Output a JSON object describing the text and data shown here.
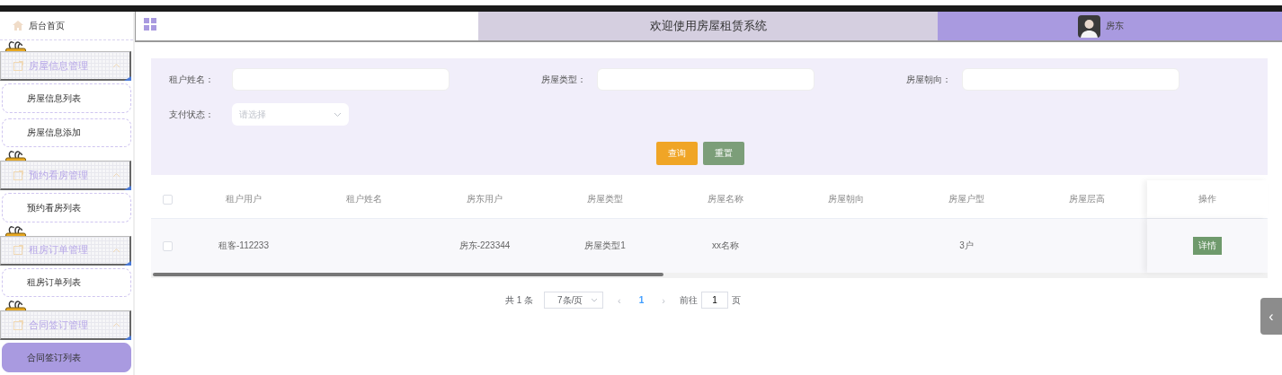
{
  "header": {
    "title": "欢迎使用房屋租赁系统",
    "user": "房东"
  },
  "sidebar": {
    "home": "后台首页",
    "groups": [
      {
        "title": "房屋信息管理",
        "expanded": true,
        "items": [
          {
            "label": "房屋信息列表",
            "selected": false
          },
          {
            "label": "房屋信息添加",
            "selected": false
          }
        ]
      },
      {
        "title": "预约看房管理",
        "expanded": true,
        "items": [
          {
            "label": "预约看房列表",
            "selected": false
          }
        ]
      },
      {
        "title": "租房订单管理",
        "expanded": true,
        "items": [
          {
            "label": "租房订单列表",
            "selected": false
          }
        ]
      },
      {
        "title": "合同签订管理",
        "expanded": true,
        "items": [
          {
            "label": "合同签订列表",
            "selected": true
          }
        ]
      }
    ]
  },
  "filters": [
    {
      "label": "租户姓名：",
      "kind": "input"
    },
    {
      "label": "房屋类型：",
      "kind": "input"
    },
    {
      "label": "房屋朝向：",
      "kind": "input"
    },
    {
      "label": "支付状态：",
      "kind": "select",
      "placeholder": "请选择"
    }
  ],
  "buttons": [
    {
      "label": "查询",
      "kind": "search"
    },
    {
      "label": "重置",
      "kind": "reset"
    }
  ],
  "table": {
    "all_checked": false,
    "columns": [
      "租户用户",
      "租户姓名",
      "房东用户",
      "房屋类型",
      "房屋名称",
      "房屋朝向",
      "房屋户型",
      "房屋层高"
    ],
    "action_column": "操作",
    "rows": [
      {
        "checked": false,
        "cells": [
          "租客-112233",
          null,
          "房东-223344",
          "房屋类型1",
          "xx名称",
          null,
          "3户",
          null
        ],
        "action": "详情"
      }
    ]
  },
  "pagination": {
    "total": "共 1 条",
    "page_size": "7条/页",
    "prev": "‹",
    "pages": [
      {
        "label": "1",
        "selected": true
      }
    ],
    "next": "›",
    "goto_label": "前往",
    "goto_value": "1",
    "goto_suffix": "页"
  },
  "side_tab": {
    "label": "‹"
  }
}
